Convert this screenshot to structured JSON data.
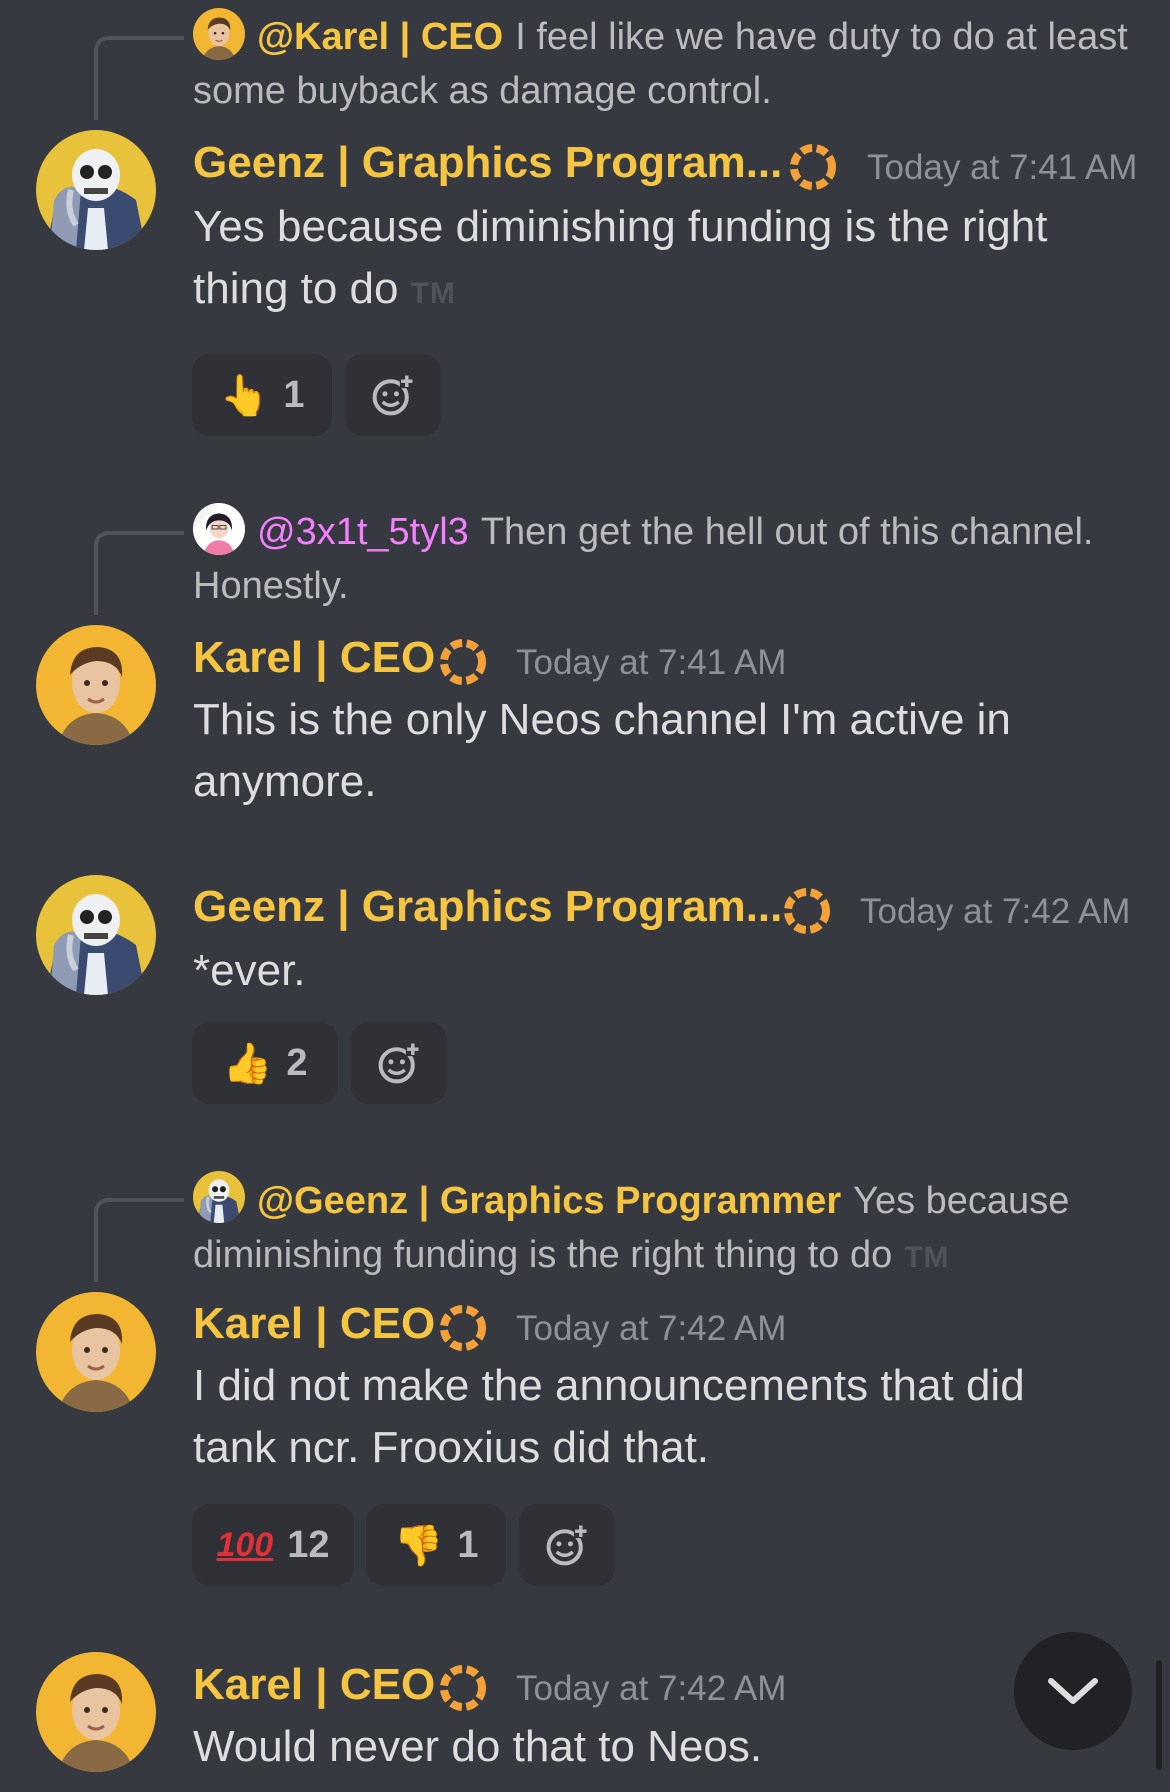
{
  "colors": {
    "background": "#36393f",
    "username": "#f5c542",
    "mention_pink": "#f47fff",
    "timestamp": "#8e9297",
    "text": "#dcddde",
    "reaction_bg": "#2f3136"
  },
  "messages": [
    {
      "reply": {
        "mention": "@Karel | CEO",
        "text": "I feel like we have duty to do at least some buyback as damage control."
      },
      "author": "Geenz | Graphics Program...",
      "time": "Today at 7:41 AM",
      "text": "Yes because diminishing funding is the right thing to do",
      "tm": "TM",
      "reactions": [
        {
          "emoji": "point-up-emoji",
          "count": "1"
        }
      ]
    },
    {
      "reply": {
        "mention": "@3x1t_5tyl3",
        "text": "Then get the hell out of this channel. Honestly."
      },
      "author": "Karel | CEO",
      "time": "Today at 7:41 AM",
      "text": "This is the only Neos channel I'm active in anymore."
    },
    {
      "author": "Geenz | Graphics Program...",
      "time": "Today at 7:42 AM",
      "text": "*ever.",
      "reactions": [
        {
          "emoji": "thumbs-up-emoji",
          "count": "2"
        }
      ]
    },
    {
      "reply": {
        "mention": "@Geenz | Graphics Programmer",
        "text": "Yes because diminishing funding is the right thing to do",
        "tm": "TM"
      },
      "author": "Karel | CEO",
      "time": "Today at 7:42 AM",
      "text": "I did not make the announcements that did tank ncr. Frooxius did that.",
      "reactions": [
        {
          "emoji": "hundred-points-emoji",
          "label": "100",
          "count": "12"
        },
        {
          "emoji": "thumbs-down-emoji",
          "count": "1"
        }
      ]
    },
    {
      "author": "Karel | CEO",
      "time": "Today at 7:42 AM",
      "text": "Would never do that to Neos."
    }
  ]
}
